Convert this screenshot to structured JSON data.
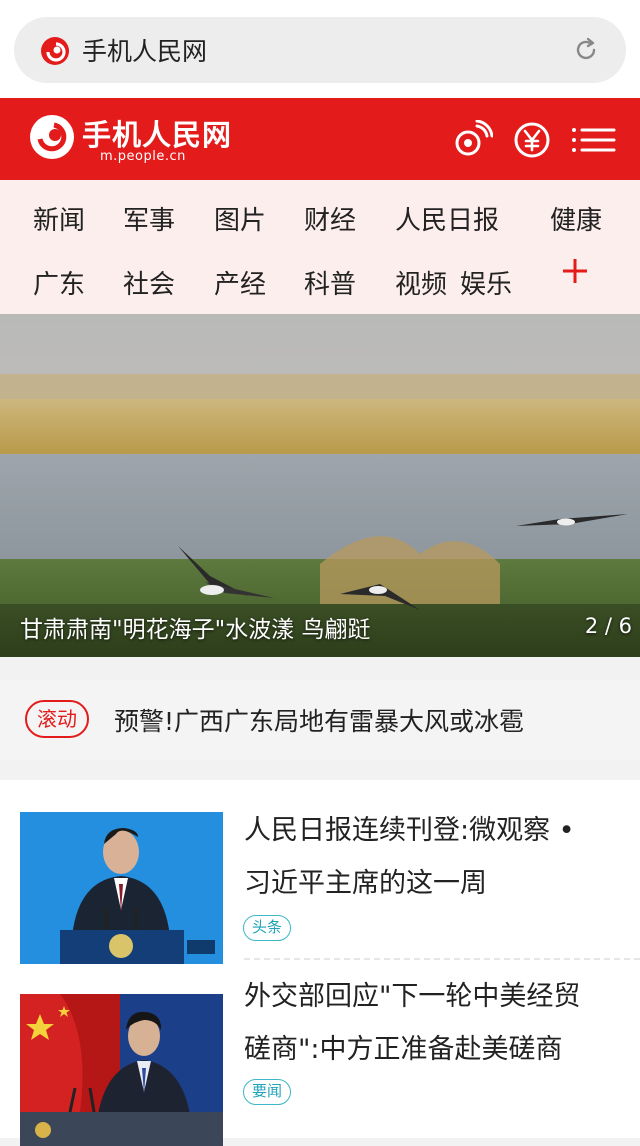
{
  "browser": {
    "url_text": "手机人民网"
  },
  "header": {
    "brand_title": "手机人民网",
    "brand_domain": "m.people.cn",
    "icons": [
      "broadcast-icon",
      "yuan-icon",
      "menu-icon"
    ]
  },
  "channels": {
    "row1": [
      "新闻",
      "军事",
      "图片",
      "财经",
      "人民日报",
      "健康"
    ],
    "row2": [
      "广东",
      "社会",
      "产经",
      "科普",
      "视频",
      "娱乐"
    ],
    "add_symbol": "+"
  },
  "hero": {
    "caption": "甘肃肃南\"明花海子\"水波漾 鸟翩跹",
    "counter": "2 / 6"
  },
  "ticker": {
    "badge": "滚动",
    "text": "预警!广西广东局地有雷暴大风或冰雹"
  },
  "news": [
    {
      "title_line1": "人民日报连续刊登:微观察 •",
      "title_line2": "习近平主席的这一周",
      "tag": "头条"
    },
    {
      "title_line1": "外交部回应\"下一轮中美经贸",
      "title_line2": "磋商\":中方正准备赴美磋商",
      "tag": "要闻"
    }
  ],
  "colors": {
    "brand_red": "#e31b1b",
    "nav_bg": "#fdeeee",
    "tag_teal": "#3bb7c8"
  }
}
